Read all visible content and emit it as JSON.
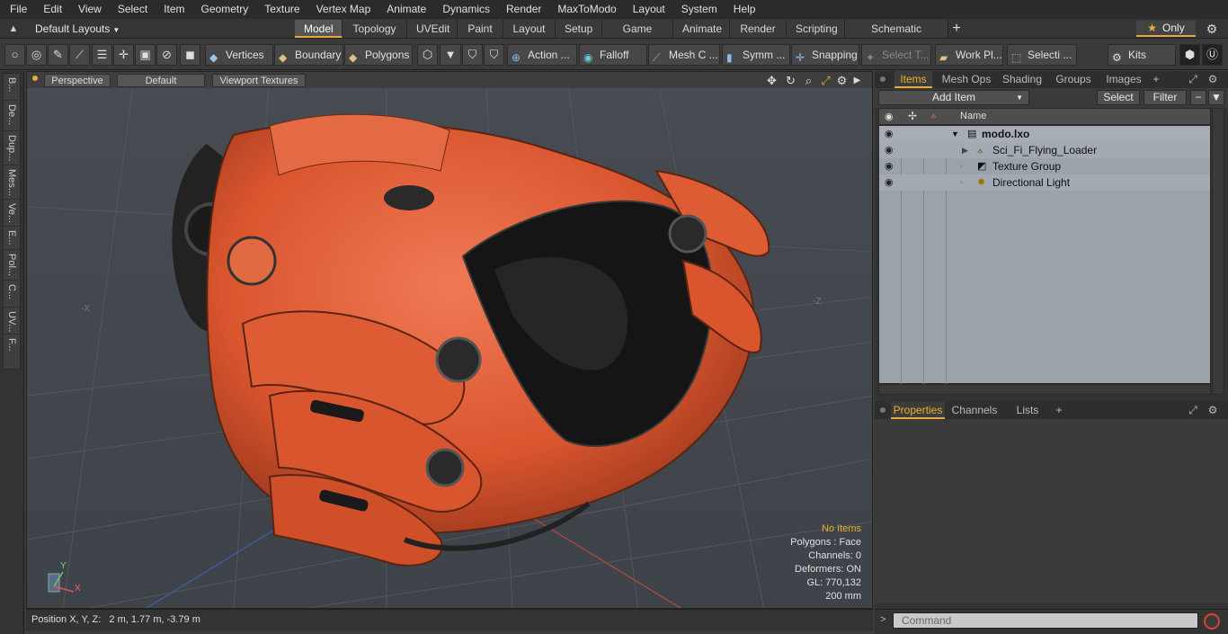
{
  "menu": [
    "File",
    "Edit",
    "View",
    "Select",
    "Item",
    "Geometry",
    "Texture",
    "Vertex Map",
    "Animate",
    "Dynamics",
    "Render",
    "MaxToModo",
    "Layout",
    "System",
    "Help"
  ],
  "layout": {
    "select_label": "Default Layouts",
    "only_label": "Only"
  },
  "tabs": [
    "Model",
    "Topology",
    "UVEdit",
    "Paint",
    "Layout",
    "Setup",
    "Game Tools",
    "Animate",
    "Render",
    "Scripting",
    "Schematic Fusion"
  ],
  "active_tab": "Model",
  "toolbar": {
    "vertices": "Vertices",
    "boundary": "Boundary",
    "polygons": "Polygons",
    "action": "Action ...",
    "falloff": "Falloff",
    "meshc": "Mesh C ...",
    "symm": "Symm ...",
    "snapping": "Snapping",
    "selectt": "Select T...",
    "workpl": "Work Pl...",
    "selecti": "Selecti ...",
    "kits": "Kits"
  },
  "left_tabs": [
    "B...",
    "De...",
    "Dup...",
    "Mes...",
    "Ve...",
    "E...",
    "Pol...",
    "C...",
    "UV...",
    "F..."
  ],
  "viewport": {
    "view_mode": "Perspective",
    "shading": "Default",
    "textures": "Viewport Textures",
    "info": {
      "selection": "No Items",
      "polygons": "Polygons : Face",
      "channels": "Channels: 0",
      "deformers": "Deformers: ON",
      "gl": "GL: 770,132",
      "scale": "200 mm"
    },
    "axis_y": "Y",
    "axis_x": "X",
    "axis_neg_x": "-X",
    "axis_neg_z": "-Z"
  },
  "status": {
    "position": "Position X, Y, Z:   2 m, 1.77 m, -3.79 m"
  },
  "items_panel": {
    "tabs": [
      "Items",
      "Mesh Ops",
      "Shading",
      "Groups",
      "Images"
    ],
    "add_item": "Add Item",
    "select": "Select",
    "filter": "Filter",
    "column_name": "Name",
    "rows": [
      {
        "name": "modo.lxo",
        "indent": 0
      },
      {
        "name": "Sci_Fi_Flying_Loader",
        "indent": 1
      },
      {
        "name": "Texture Group",
        "indent": 1
      },
      {
        "name": "Directional Light",
        "indent": 1
      }
    ]
  },
  "properties_panel": {
    "tabs": [
      "Properties",
      "Channels",
      "Lists"
    ]
  },
  "command": {
    "placeholder": "Command"
  },
  "colors": {
    "accent": "#e8a640",
    "model_orange": "#d9552e",
    "viewport_bg": "#4a4f56",
    "items_bg": "#9aa2aa"
  }
}
